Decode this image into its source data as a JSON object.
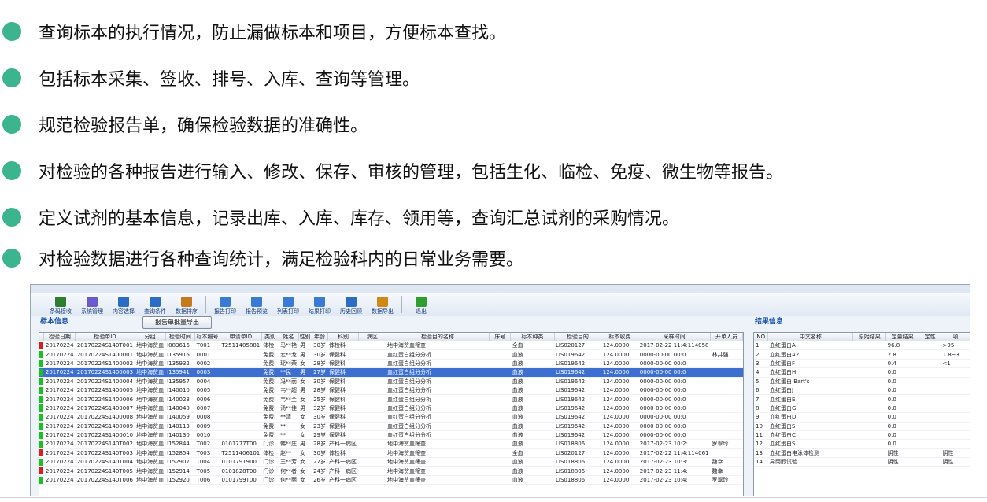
{
  "bullets": [
    "查询标本的执行情况，防止漏做标本和项目，方便标本查找。",
    "包括标本采集、签收、排号、入库、查询等管理。",
    "规范检验报告单，确保检验数据的准确性。",
    "对检验的各种报告进行输入、修改、保存、审核的管理，包括生化、临检、免疫、微生物等报告。",
    "定义试剂的基本信息，记录出库、入库、库存、领用等，查询汇总试剂的采购情况。",
    "对检验数据进行各种查询统计，满足检验科内的日常业务需要。"
  ],
  "colors": {
    "bullet": "#3cb48e",
    "selected_row": "#3d6fd0",
    "panel_title": "#1a56a8",
    "mark_green": "#19c21f",
    "mark_red": "#e01b1b"
  },
  "toolbar": [
    {
      "label": "条码接收",
      "icon": "barcode-icon"
    },
    {
      "label": "系统管理",
      "icon": "settings-icon"
    },
    {
      "label": "内容选择",
      "icon": "select-icon"
    },
    {
      "label": "查询条件",
      "icon": "search-icon"
    },
    {
      "label": "数据排序",
      "icon": "sort-icon"
    },
    {
      "label": "报告打印",
      "icon": "print-icon"
    },
    {
      "label": "报告预览",
      "icon": "preview-icon"
    },
    {
      "label": "列表打印",
      "icon": "list-print-icon"
    },
    {
      "label": "结果打印",
      "icon": "result-print-icon"
    },
    {
      "label": "历史回顾",
      "icon": "history-icon"
    },
    {
      "label": "数据导出",
      "icon": "export-icon"
    },
    {
      "label": "退出",
      "icon": "exit-icon"
    }
  ],
  "left_panel": {
    "title": "标本信息",
    "export_button": "报告单批量导出",
    "columns": [
      "检验日期",
      "检验单ID",
      "分组",
      "检验时间",
      "标本编号",
      "申请单ID",
      "类别",
      "姓名",
      "性别",
      "年龄",
      "科别",
      "病区",
      "检验目的名称",
      "床号",
      "标本种类",
      "检验目的",
      "标本收费",
      "采样时间",
      "开单人员"
    ],
    "rows": [
      {
        "mark": "red",
        "selected": false,
        "cells": [
          "20170224",
          "20170224S140T001",
          "地中海贫血",
          "I083616",
          "T001",
          "T2511405881",
          "体检",
          "马**艳",
          "男",
          "30岁",
          "体检科",
          "",
          "地中海贫血筛查",
          "",
          "全血",
          "LIS020127",
          "124.0000",
          "2017-02-22 11:4:114058",
          ""
        ]
      },
      {
        "mark": "green",
        "selected": false,
        "cells": [
          "20170224",
          "20170224S1400001",
          "地中海贫血",
          "I135916",
          "0001",
          "",
          "免费I",
          "宏**龙",
          "男",
          "30岁",
          "保健科",
          "",
          "血红蛋白组分分析",
          "",
          "血液",
          "LIS019642",
          "124.0000",
          "0000-00-00 00:0",
          "林并强"
        ]
      },
      {
        "mark": "green",
        "selected": false,
        "cells": [
          "20170224",
          "20170224S1400002",
          "地中海贫血",
          "I135932",
          "0002",
          "",
          "免费I",
          "瑶**荣",
          "女",
          "28岁",
          "保健科",
          "",
          "血红蛋白组分分析",
          "",
          "血液",
          "LIS019642",
          "124.0000",
          "0000-00-00 00:0",
          ""
        ]
      },
      {
        "mark": "green",
        "selected": true,
        "cells": [
          "20170224",
          "20170224S1400003",
          "地中海贫血",
          "I135941",
          "0003",
          "",
          "免费I",
          "**民",
          "男",
          "27岁",
          "保健科",
          "",
          "血红蛋白组分分析",
          "",
          "血液",
          "LIS019642",
          "124.0000",
          "0000-00-00 00:0",
          ""
        ]
      },
      {
        "mark": "green",
        "selected": false,
        "cells": [
          "20170224",
          "20170224S1400004",
          "地中海贫血",
          "I135957",
          "0004",
          "",
          "免费I",
          "冯**丽",
          "女",
          "30岁",
          "保健科",
          "",
          "血红蛋白组分分析",
          "",
          "血液",
          "LIS019642",
          "124.0000",
          "0000-00-00 00:0",
          ""
        ]
      },
      {
        "mark": "green",
        "selected": false,
        "cells": [
          "20170224",
          "20170224S1400005",
          "地中海贫血",
          "I140010",
          "0005",
          "",
          "免费I",
          "韦**超",
          "男",
          "28岁",
          "保健科",
          "",
          "血红蛋白组分分析",
          "",
          "血液",
          "LIS019642",
          "124.0000",
          "0000-00-00 00:0",
          ""
        ]
      },
      {
        "mark": "green",
        "selected": false,
        "cells": [
          "20170224",
          "20170224S1400006",
          "地中海贫血",
          "I140023",
          "0006",
          "",
          "免费I",
          "韦**兰",
          "女",
          "25岁",
          "保健科",
          "",
          "血红蛋白组分分析",
          "",
          "血液",
          "LIS019642",
          "124.0000",
          "0000-00-00 00:0",
          ""
        ]
      },
      {
        "mark": "green",
        "selected": false,
        "cells": [
          "20170224",
          "20170224S1400007",
          "地中海贫血",
          "I140040",
          "0007",
          "",
          "免费I",
          "汤**佳",
          "男",
          "32岁",
          "保健科",
          "",
          "血红蛋白组分分析",
          "",
          "血液",
          "LIS019642",
          "124.0000",
          "0000-00-00 00:0",
          ""
        ]
      },
      {
        "mark": "green",
        "selected": false,
        "cells": [
          "20170224",
          "20170224S1400008",
          "地中海贫血",
          "I140059",
          "0008",
          "",
          "免费I",
          "**清",
          "女",
          "30岁",
          "保健科",
          "",
          "血红蛋白组分分析",
          "",
          "血液",
          "LIS019642",
          "124.0000",
          "0000-00-00 00:0",
          ""
        ]
      },
      {
        "mark": "green",
        "selected": false,
        "cells": [
          "20170224",
          "20170224S1400009",
          "地中海贫血",
          "I140113",
          "0009",
          "",
          "免费I",
          "**",
          "女",
          "23岁",
          "保健科",
          "",
          "血红蛋白组分分析",
          "",
          "血液",
          "LIS019642",
          "124.0000",
          "0000-00-00 00:0",
          ""
        ]
      },
      {
        "mark": "green",
        "selected": false,
        "cells": [
          "20170224",
          "20170224S1400010",
          "地中海贫血",
          "I140130",
          "0010",
          "",
          "免费I",
          "**",
          "女",
          "29岁",
          "保健科",
          "",
          "血红蛋白组分分析",
          "",
          "血液",
          "LIS019642",
          "124.0000",
          "0000-00-00 00:0",
          ""
        ]
      },
      {
        "mark": "green",
        "selected": false,
        "cells": [
          "20170224",
          "20170224S140T002",
          "地中海贫血",
          "I152844",
          "T002",
          "0101777T00",
          "门诊",
          "韩**庄",
          "男",
          "28岁",
          "产科一病区",
          "",
          "地中海贫血筛查",
          "",
          "血液",
          "LIS018806",
          "124.0000",
          "2017-02-23 10:2:",
          "罗翠玲"
        ]
      },
      {
        "mark": "red",
        "selected": false,
        "cells": [
          "20170224",
          "20170224S140T003",
          "地中海贫血",
          "I152854",
          "T003",
          "T2511406101",
          "体检",
          "赵**",
          "女",
          "30岁",
          "体检科",
          "",
          "地中海贫血筛查",
          "",
          "全血",
          "LIS020127",
          "124.0000",
          "2017-02-22 11:4:114061",
          ""
        ]
      },
      {
        "mark": "green",
        "selected": false,
        "cells": [
          "20170224",
          "20170224S140T004",
          "地中海贫血",
          "I152907",
          "T004",
          "0101791900",
          "门诊",
          "王**芳",
          "女",
          "27岁",
          "产科一病区",
          "",
          "地中海贫血筛查",
          "",
          "血液",
          "LIS018806",
          "124.0000",
          "2017-02-23 10:3:",
          "魏幸"
        ]
      },
      {
        "mark": "red",
        "selected": false,
        "cells": [
          "20170224",
          "20170224S140T005",
          "地中海贫血",
          "I152914",
          "T005",
          "0101828T00",
          "门诊",
          "何**者",
          "女",
          "24岁",
          "产科一病区",
          "",
          "地中海贫血筛查",
          "",
          "血液",
          "LIS018806",
          "124.0000",
          "2017-02-23 11:4:",
          "魏幸"
        ]
      },
      {
        "mark": "green",
        "selected": false,
        "cells": [
          "20170224",
          "20170224S140T006",
          "地中海贫血",
          "I152920",
          "T006",
          "0101799T00",
          "门诊",
          "何**丽",
          "女",
          "26岁",
          "产科一病区",
          "",
          "地中海贫血筛查",
          "",
          "血液",
          "LIS018806",
          "124.0000",
          "2017-02-23 10:4:",
          "罗翠玲"
        ]
      }
    ]
  },
  "right_panel": {
    "title": "结果信息",
    "columns": [
      "NO",
      "中文名称",
      "原始结果",
      "定量结果",
      "定性",
      "项"
    ],
    "rows": [
      [
        "1",
        "血红蛋白A",
        "",
        "96.8",
        "",
        ">95"
      ],
      [
        "2",
        "血红蛋白A2",
        "",
        "2.8",
        "",
        "1.8~3"
      ],
      [
        "3",
        "血红蛋白F",
        "",
        "0.4",
        "",
        "<1"
      ],
      [
        "4",
        "血红蛋白H",
        "",
        "0.0",
        "",
        ""
      ],
      [
        "5",
        "血红蛋白 Bart's",
        "",
        "0.0",
        "",
        ""
      ],
      [
        "6",
        "血红蛋白J",
        "",
        "0.0",
        "",
        ""
      ],
      [
        "7",
        "血红蛋白E",
        "",
        "0.0",
        "",
        ""
      ],
      [
        "8",
        "血红蛋白G",
        "",
        "0.0",
        "",
        ""
      ],
      [
        "9",
        "血红蛋白D",
        "",
        "0.0",
        "",
        ""
      ],
      [
        "10",
        "血红蛋白S",
        "",
        "0.0",
        "",
        ""
      ],
      [
        "11",
        "血红蛋白C",
        "",
        "0.0",
        "",
        ""
      ],
      [
        "12",
        "血红蛋白S",
        "",
        "0.0",
        "",
        ""
      ],
      [
        "13",
        "血红蛋白电泳体检测",
        "",
        "阴性",
        "",
        "阴性"
      ],
      [
        "14",
        "异丙醇试验",
        "",
        "阴性",
        "",
        "阴性"
      ]
    ]
  }
}
